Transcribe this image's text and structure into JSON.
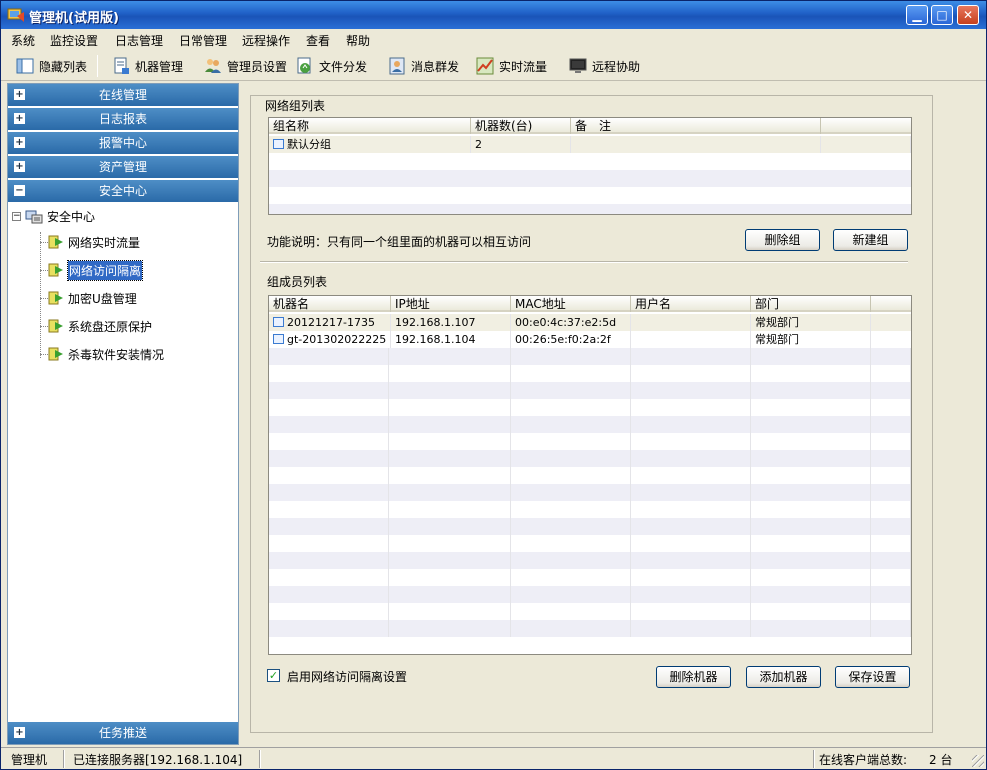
{
  "window": {
    "title": "管理机(试用版)"
  },
  "menu": [
    "系统",
    "监控设置",
    "日志管理",
    "日常管理",
    "远程操作",
    "查看",
    "帮助"
  ],
  "toolbar": {
    "hide_list": "隐藏列表",
    "machine_mgmt": "机器管理",
    "admin_settings": "管理员设置",
    "file_dist": "文件分发",
    "msg_broadcast": "消息群发",
    "realtime_traffic": "实时流量",
    "remote_assist": "远程协助"
  },
  "sidebar": {
    "sections": [
      {
        "label": "在线管理",
        "state": "+"
      },
      {
        "label": "日志报表",
        "state": "+"
      },
      {
        "label": "报警中心",
        "state": "+"
      },
      {
        "label": "资产管理",
        "state": "+"
      },
      {
        "label": "安全中心",
        "state": "−"
      }
    ],
    "tree_root": "安全中心",
    "tree_items": [
      "网络实时流量",
      "网络访问隔离",
      "加密U盘管理",
      "系统盘还原保护",
      "杀毒软件安装情况"
    ],
    "selected_index": 1,
    "bottom_section": {
      "label": "任务推送",
      "state": "+"
    }
  },
  "group_list": {
    "title": "网络组列表",
    "columns": [
      "组名称",
      "机器数(台)",
      "备　注"
    ],
    "rows": [
      {
        "name": "默认分组",
        "count": "2",
        "note": ""
      }
    ]
  },
  "function_note": "功能说明：只有同一个组里面的机器可以相互访问",
  "buttons": {
    "delete_group": "删除组",
    "new_group": "新建组",
    "delete_machine": "删除机器",
    "add_machine": "添加机器",
    "save_settings": "保存设置"
  },
  "member_list": {
    "title": "组成员列表",
    "columns": [
      "机器名",
      "IP地址",
      "MAC地址",
      "用户名",
      "部门"
    ],
    "rows": [
      {
        "name": "20121217-1735",
        "ip": "192.168.1.107",
        "mac": "00:e0:4c:37:e2:5d",
        "user": "",
        "dept": "常规部门"
      },
      {
        "name": "gt-201302022225",
        "ip": "192.168.1.104",
        "mac": "00:26:5e:f0:2a:2f",
        "user": "",
        "dept": "常规部门"
      }
    ]
  },
  "enable_isolation": {
    "label": "启用网络访问隔离设置",
    "checked": true
  },
  "status": {
    "role": "管理机",
    "server": "已连接服务器[192.168.1.104]",
    "online_label": "在线客户端总数:",
    "online_count": "2 台"
  },
  "colors": {
    "title_bar": "#1f5fc6",
    "section_header": "#2a6aa8",
    "selection": "#316ac5"
  }
}
